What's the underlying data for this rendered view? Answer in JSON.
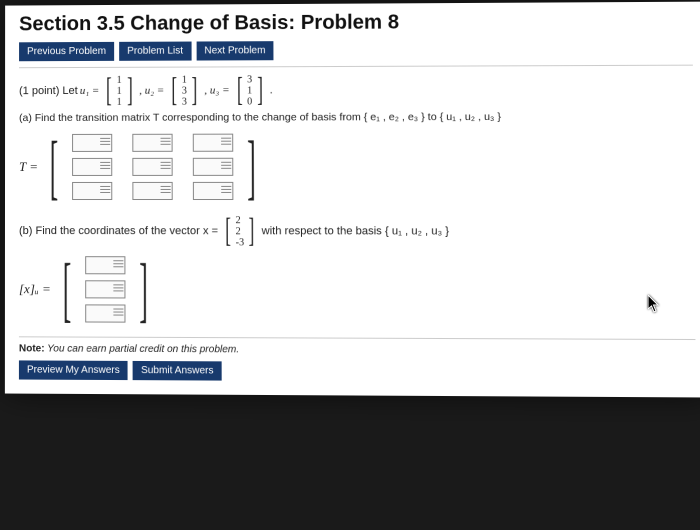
{
  "header": {
    "title": "Section 3.5 Change of Basis: Problem 8"
  },
  "nav": {
    "prev": "Previous Problem",
    "list": "Problem List",
    "next": "Next Problem"
  },
  "problem": {
    "points_prefix": "(1 point) Let ",
    "u1_lhs": "u₁ =",
    "u2_lhs": ", u₂ =",
    "u3_lhs": ", u₃ =",
    "period": ".",
    "u1": [
      "1",
      "1",
      "1"
    ],
    "u2": [
      "1",
      "3",
      "3"
    ],
    "u3": [
      "3",
      "1",
      "0"
    ]
  },
  "part_a": {
    "text_full": "(a) Find the transition matrix T corresponding to the change of basis from { e₁ , e₂ , e₃ } to { u₁ , u₂ , u₃ }",
    "lhs": "T ="
  },
  "part_b": {
    "prefix": "(b) Find the coordinates of the vector x =",
    "vec": [
      "2",
      "2",
      "-3"
    ],
    "suffix": " with respect to the basis { u₁ , u₂ , u₃ }",
    "lhs": "[x]ᵤ ="
  },
  "note": {
    "bold": "Note:",
    "text": " You can earn partial credit on this problem."
  },
  "buttons": {
    "preview": "Preview My Answers",
    "submit": "Submit Answers"
  }
}
